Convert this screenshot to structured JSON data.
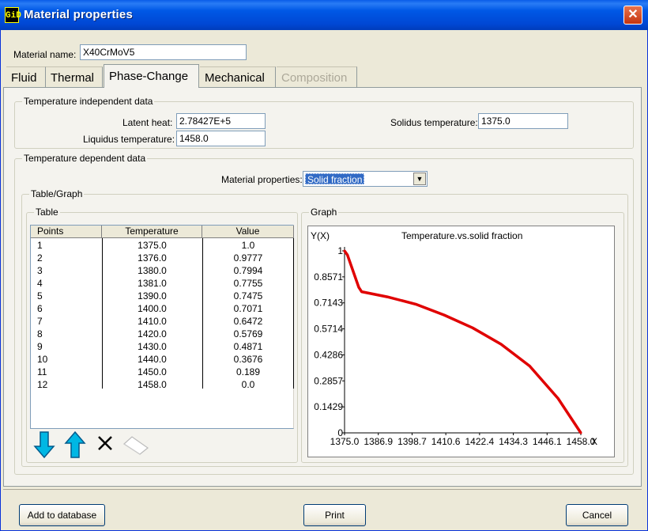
{
  "window": {
    "title": "Material properties",
    "app_icon": "GiD",
    "close_icon": "close-icon"
  },
  "material": {
    "name_label": "Material name:",
    "name_value": "X40CrMoV5"
  },
  "tabs": [
    {
      "label": "Fluid",
      "state": "normal"
    },
    {
      "label": "Thermal",
      "state": "normal"
    },
    {
      "label": "Phase-Change",
      "state": "active"
    },
    {
      "label": "Mechanical",
      "state": "normal"
    },
    {
      "label": "Composition",
      "state": "disabled"
    }
  ],
  "temp_independent": {
    "title": "Temperature independent data",
    "latent_heat_label": "Latent heat:",
    "latent_heat_value": "2.78427E+5",
    "liquidus_label": "Liquidus temperature:",
    "liquidus_value": "1458.0",
    "solidus_label": "Solidus temperature:",
    "solidus_value": "1375.0"
  },
  "temp_dependent": {
    "title": "Temperature dependent data",
    "material_props_label": "Material properties:",
    "material_props_selected": "Solid fraction",
    "table_graph_title": "Table/Graph",
    "table_title": "Table",
    "graph_title": "Graph"
  },
  "table": {
    "columns": [
      "Points",
      "Temperature",
      "Value"
    ],
    "rows": [
      [
        "1",
        "1375.0",
        "1.0"
      ],
      [
        "2",
        "1376.0",
        "0.9777"
      ],
      [
        "3",
        "1380.0",
        "0.7994"
      ],
      [
        "4",
        "1381.0",
        "0.7755"
      ],
      [
        "5",
        "1390.0",
        "0.7475"
      ],
      [
        "6",
        "1400.0",
        "0.7071"
      ],
      [
        "7",
        "1410.0",
        "0.6472"
      ],
      [
        "8",
        "1420.0",
        "0.5769"
      ],
      [
        "9",
        "1430.0",
        "0.4871"
      ],
      [
        "10",
        "1440.0",
        "0.3676"
      ],
      [
        "11",
        "1450.0",
        "0.189"
      ],
      [
        "12",
        "1458.0",
        "0.0"
      ]
    ]
  },
  "toolbar": {
    "icons": [
      "arrow-down-icon",
      "arrow-up-icon",
      "delete-x-icon",
      "eraser-icon"
    ]
  },
  "chart_data": {
    "type": "line",
    "title": "Temperature.vs.solid fraction",
    "ylabel": "Y(X)",
    "xlabel": "X",
    "x": [
      1375.0,
      1376.0,
      1380.0,
      1381.0,
      1390.0,
      1400.0,
      1410.0,
      1420.0,
      1430.0,
      1440.0,
      1450.0,
      1458.0
    ],
    "y": [
      1.0,
      0.9777,
      0.7994,
      0.7755,
      0.7475,
      0.7071,
      0.6472,
      0.5769,
      0.4871,
      0.3676,
      0.189,
      0.0
    ],
    "xlim": [
      1375.0,
      1458.0
    ],
    "ylim": [
      0,
      1
    ],
    "xticks": [
      "1375.0",
      "1386.9",
      "1398.7",
      "1410.6",
      "1422.4",
      "1434.3",
      "1446.1",
      "1458.0"
    ],
    "yticks": [
      "1",
      "0.8571",
      "0.7143",
      "0.5714",
      "0.4286",
      "0.2857",
      "0.1429",
      "0"
    ],
    "line_color": "#e00000",
    "grid": false
  },
  "buttons": {
    "add_to_database": "Add to database",
    "print": "Print",
    "cancel": "Cancel"
  },
  "colors": {
    "title_bar": "#0058e6",
    "selection": "#316ac5",
    "curve": "#e00000"
  }
}
